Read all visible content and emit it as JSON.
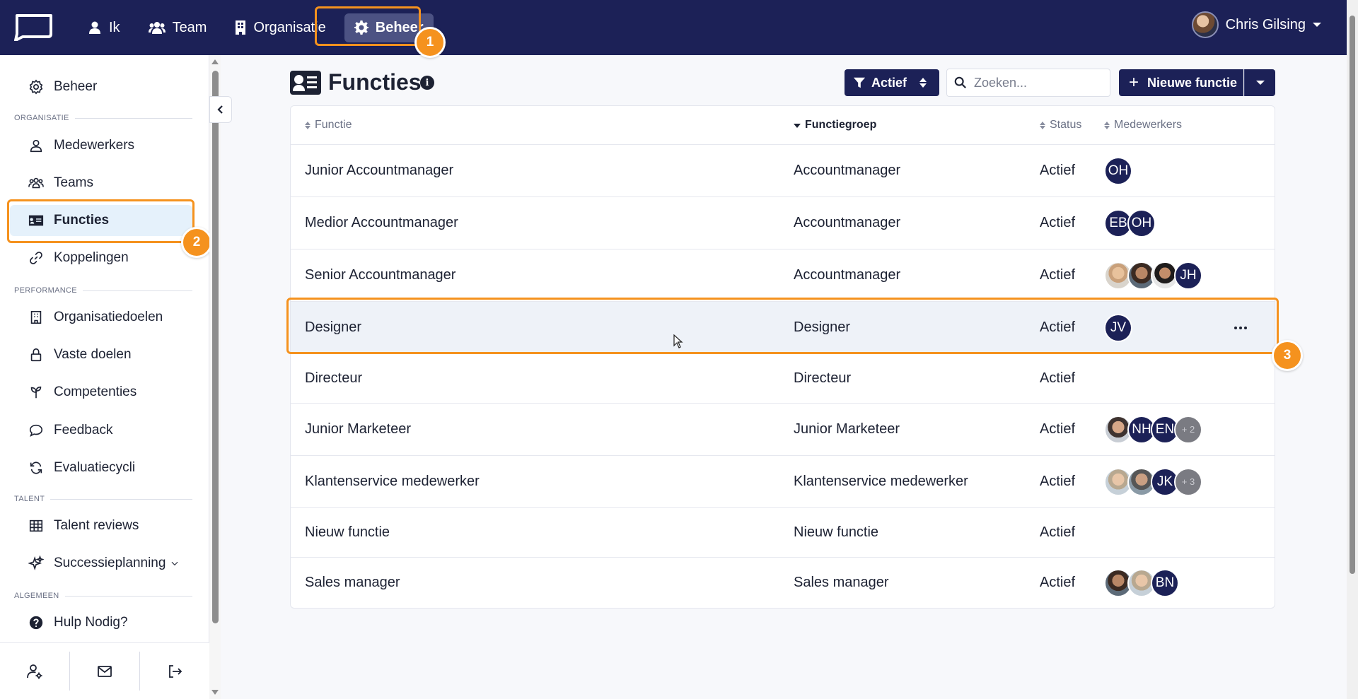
{
  "topnav": {
    "items": [
      {
        "label": "Ik",
        "icon": "user-icon"
      },
      {
        "label": "Team",
        "icon": "users-icon"
      },
      {
        "label": "Organisatie",
        "icon": "building-icon"
      },
      {
        "label": "Beheer",
        "icon": "gear-icon",
        "active": true
      }
    ],
    "user_name": "Chris Gilsing"
  },
  "badges": [
    "1",
    "2",
    "3"
  ],
  "sidebar": {
    "top_item": "Beheer",
    "sections": [
      "ORGANISATIE",
      "PERFORMANCE",
      "TALENT",
      "ALGEMEEN"
    ],
    "items": [
      {
        "label": "Medewerkers",
        "icon": "user-icon"
      },
      {
        "label": "Teams",
        "icon": "users-icon"
      },
      {
        "label": "Functies",
        "icon": "id-card-icon",
        "active": true
      },
      {
        "label": "Koppelingen",
        "icon": "link-icon"
      },
      {
        "label": "Organisatiedoelen",
        "icon": "building-icon"
      },
      {
        "label": "Vaste doelen",
        "icon": "lock-icon"
      },
      {
        "label": "Competenties",
        "icon": "seedling-icon"
      },
      {
        "label": "Feedback",
        "icon": "comment-icon"
      },
      {
        "label": "Evaluatiecycli",
        "icon": "refresh-icon"
      },
      {
        "label": "Talent reviews",
        "icon": "grid-icon"
      },
      {
        "label": "Successieplanning",
        "icon": "sparkle-icon"
      },
      {
        "label": "Hulp Nodig?",
        "icon": "question-icon"
      }
    ]
  },
  "page": {
    "title": "Functies",
    "filter_label": "Actief",
    "search_placeholder": "Zoeken...",
    "new_button": "Nieuwe functie"
  },
  "table": {
    "columns": [
      "Functie",
      "Functiegroep",
      "Status",
      "Medewerkers"
    ],
    "rows": [
      {
        "functie": "Junior Accountmanager",
        "groep": "Accountmanager",
        "status": "Actief",
        "avatars": [
          "OH"
        ]
      },
      {
        "functie": "Medior Accountmanager",
        "groep": "Accountmanager",
        "status": "Actief",
        "avatars": [
          "EB",
          "OH"
        ]
      },
      {
        "functie": "Senior Accountmanager",
        "groep": "Accountmanager",
        "status": "Actief",
        "avatars": [
          "photo",
          "photo",
          "photo",
          "JH"
        ]
      },
      {
        "functie": "Designer",
        "groep": "Designer",
        "status": "Actief",
        "avatars": [
          "JV"
        ]
      },
      {
        "functie": "Directeur",
        "groep": "Directeur",
        "status": "Actief",
        "avatars": []
      },
      {
        "functie": "Junior Marketeer",
        "groep": "Junior Marketeer",
        "status": "Actief",
        "avatars": [
          "photo",
          "NH",
          "EN",
          "+ 2"
        ]
      },
      {
        "functie": "Klantenservice medewerker",
        "groep": "Klantenservice medewerker",
        "status": "Actief",
        "avatars": [
          "photo",
          "photo",
          "JK",
          "+ 3"
        ]
      },
      {
        "functie": "Nieuw functie",
        "groep": "Nieuw functie",
        "status": "Actief",
        "avatars": []
      },
      {
        "functie": "Sales manager",
        "groep": "Sales manager",
        "status": "Actief",
        "avatars": [
          "photo",
          "photo",
          "BN"
        ]
      }
    ]
  },
  "colors": {
    "navy": "#1c2157",
    "highlight": "#f5921e",
    "active_bg": "#e5f1fb"
  }
}
